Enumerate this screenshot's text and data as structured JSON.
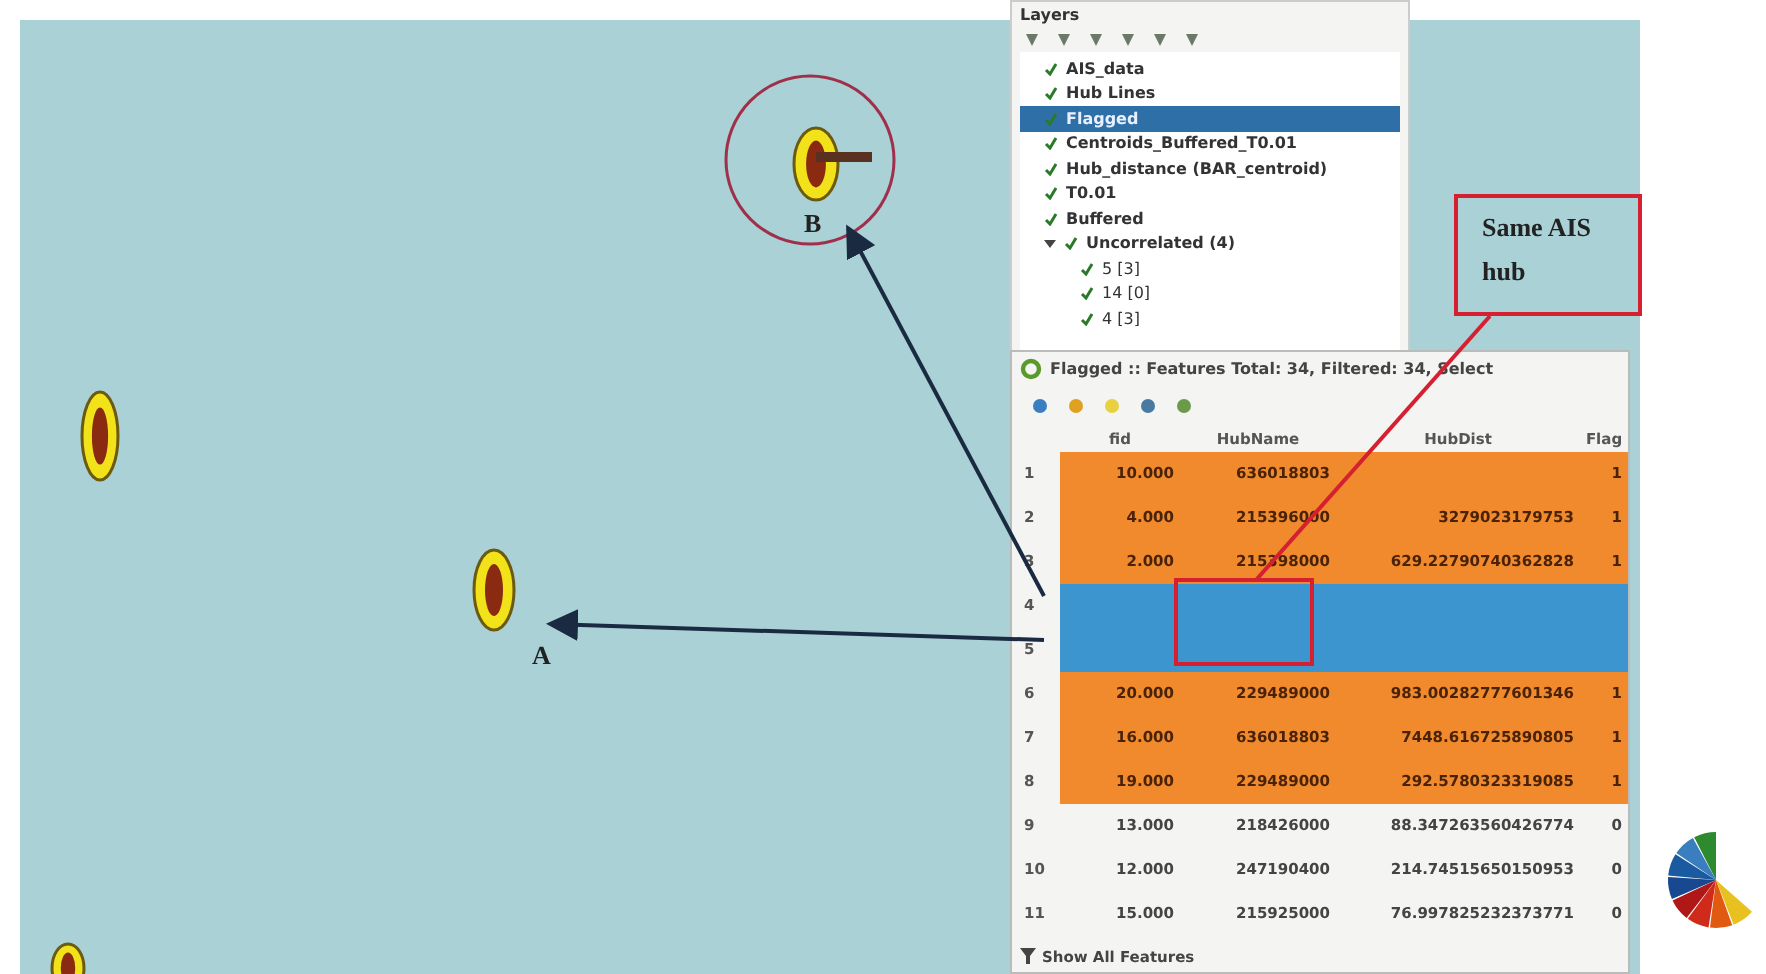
{
  "map": {
    "labels": [
      {
        "text": "A"
      },
      {
        "text": "B"
      }
    ],
    "callout": "Same AIS hub"
  },
  "layers_panel": {
    "title": "Layers",
    "items": [
      {
        "name": "AIS_data",
        "checked": true,
        "selected": false
      },
      {
        "name": "Hub Lines",
        "checked": true,
        "selected": false
      },
      {
        "name": "Flagged",
        "checked": true,
        "selected": true
      },
      {
        "name": "Centroids_Buffered_T0.01",
        "checked": true,
        "selected": false
      },
      {
        "name": "Hub_distance (BAR_centroid)",
        "checked": true,
        "selected": false
      },
      {
        "name": "T0.01",
        "checked": true,
        "selected": false
      },
      {
        "name": "Buffered",
        "checked": true,
        "selected": false
      },
      {
        "name": "Uncorrelated (4)",
        "checked": true,
        "selected": false,
        "expanded": true,
        "children": [
          {
            "name": "5 [3]",
            "checked": true,
            "selected": false
          },
          {
            "name": "14 [0]",
            "checked": true,
            "selected": false
          },
          {
            "name": "4 [3]",
            "checked": true,
            "selected": false
          }
        ]
      }
    ]
  },
  "attribute_table": {
    "title": "Flagged :: Features Total: 34, Filtered: 34, Select",
    "columns": [
      "fid",
      "HubName",
      "HubDist",
      "Flag"
    ],
    "rows": [
      {
        "index": "1",
        "fid": "10.000",
        "hub_name": "636018803",
        "flagged": true,
        "selected": false,
        "flag": "1"
      },
      {
        "index": "2",
        "fid": "4.000",
        "hub_name": "215396000",
        "hub_dist": "3279023179753",
        "flagged": true,
        "selected": false,
        "flag": "1"
      },
      {
        "index": "3",
        "fid": "2.000",
        "hub_name": "215398000",
        "hub_dist": "629.22790740362828",
        "flagged": true,
        "selected": false,
        "flag": "1"
      },
      {
        "index": "4",
        "flagged": false,
        "selected": true
      },
      {
        "index": "5",
        "flagged": false,
        "selected": true
      },
      {
        "index": "6",
        "fid": "20.000",
        "hub_name": "229489000",
        "hub_dist": "983.00282777601346",
        "flagged": true,
        "selected": false,
        "flag": "1"
      },
      {
        "index": "7",
        "fid": "16.000",
        "hub_name": "636018803",
        "hub_dist": "7448.616725890805",
        "flagged": true,
        "selected": false,
        "flag": "1"
      },
      {
        "index": "8",
        "fid": "19.000",
        "hub_name": "229489000",
        "hub_dist": "292.5780323319085",
        "flagged": true,
        "selected": false,
        "flag": "1"
      },
      {
        "index": "9",
        "fid": "13.000",
        "hub_name": "218426000",
        "hub_dist": "88.347263560426774",
        "flagged": false,
        "selected": false,
        "flag": "0"
      },
      {
        "index": "10",
        "fid": "12.000",
        "hub_name": "247190400",
        "hub_dist": "214.74515650150953",
        "flagged": false,
        "selected": false,
        "flag": "0"
      },
      {
        "index": "11",
        "fid": "15.000",
        "hub_name": "215925000",
        "hub_dist": "76.997825232373771",
        "flagged": false,
        "selected": false,
        "flag": "0"
      }
    ],
    "footer": "Show All Features"
  }
}
